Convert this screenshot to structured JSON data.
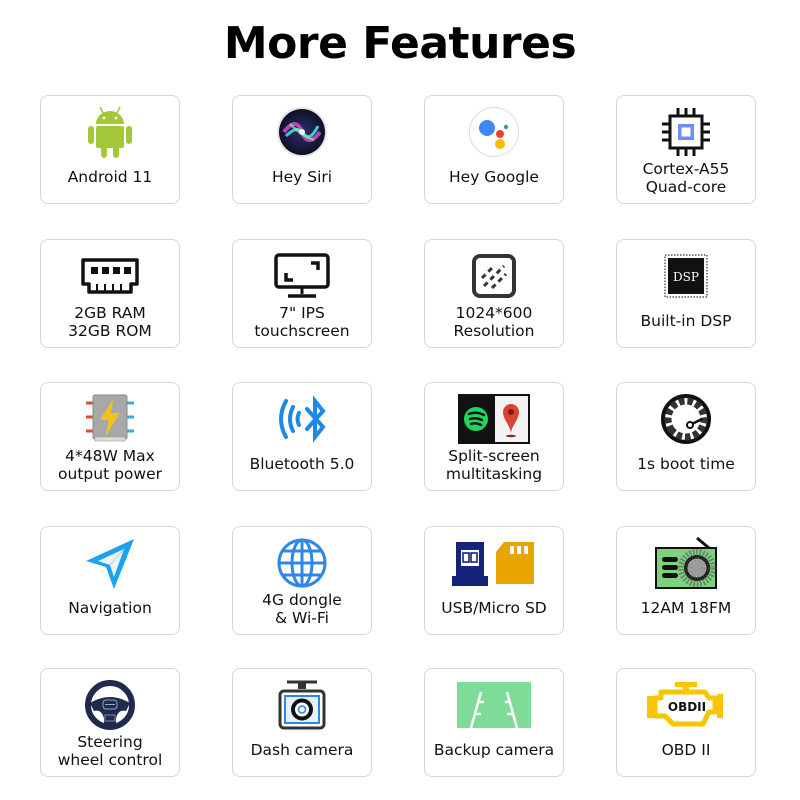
{
  "title": "More Features",
  "features": [
    {
      "icon": "android-icon",
      "lines": [
        "Android 11"
      ]
    },
    {
      "icon": "siri-icon",
      "lines": [
        "Hey Siri"
      ]
    },
    {
      "icon": "google-assistant-icon",
      "lines": [
        "Hey Google"
      ]
    },
    {
      "icon": "cpu-chip-icon",
      "lines": [
        "Cortex-A55",
        "Quad-core"
      ]
    },
    {
      "icon": "ram-module-icon",
      "lines": [
        "2GB RAM",
        "32GB ROM"
      ]
    },
    {
      "icon": "monitor-icon",
      "lines": [
        "7\" IPS",
        "touchscreen"
      ]
    },
    {
      "icon": "resolution-icon",
      "lines": [
        "1024*600",
        "Resolution"
      ]
    },
    {
      "icon": "dsp-chip-icon",
      "lines": [
        "Built-in DSP"
      ],
      "chip_text": "DSP"
    },
    {
      "icon": "power-amplifier-icon",
      "lines": [
        "4*48W Max",
        "output power"
      ]
    },
    {
      "icon": "bluetooth-icon",
      "lines": [
        "Bluetooth 5.0"
      ]
    },
    {
      "icon": "split-screen-icon",
      "lines": [
        "Split-screen",
        "multitasking"
      ]
    },
    {
      "icon": "speedometer-icon",
      "lines": [
        "1s boot time"
      ]
    },
    {
      "icon": "navigation-arrow-icon",
      "lines": [
        "Navigation"
      ]
    },
    {
      "icon": "globe-icon",
      "lines": [
        "4G dongle",
        "& Wi-Fi"
      ]
    },
    {
      "icon": "usb-sd-card-icon",
      "lines": [
        "USB/Micro SD"
      ]
    },
    {
      "icon": "radio-icon",
      "lines": [
        "12AM 18FM"
      ]
    },
    {
      "icon": "steering-wheel-icon",
      "lines": [
        "Steering",
        "wheel control"
      ]
    },
    {
      "icon": "dash-camera-icon",
      "lines": [
        "Dash camera"
      ]
    },
    {
      "icon": "backup-camera-icon",
      "lines": [
        "Backup camera"
      ]
    },
    {
      "icon": "obd-engine-icon",
      "lines": [
        "OBD II"
      ],
      "chip_text": "OBDII"
    }
  ],
  "colors": {
    "android_green": "#a4c639",
    "bluetooth_blue": "#1e88e5",
    "nav_blue": "#1aa3f0",
    "globe_blue": "#2f86e6",
    "usb_navy": "#15237a",
    "sd_gold": "#e8a400",
    "radio_green": "#7fd17f",
    "backup_green": "#7fdc98",
    "obd_yellow": "#f6c600",
    "steering_navy": "#1f2a4d",
    "card_border": "#d6d6d6"
  }
}
